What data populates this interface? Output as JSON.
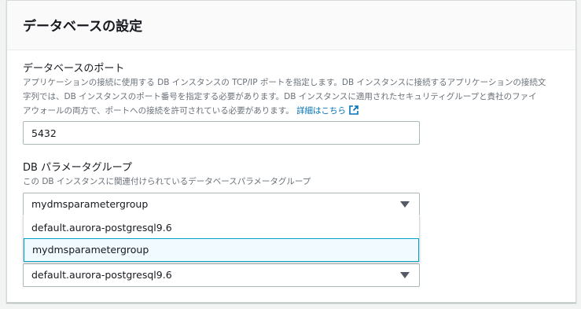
{
  "section": {
    "title": "データベースの設定"
  },
  "port": {
    "label": "データベースのポート",
    "description_line1": "アプリケーションの接続に使用する DB インスタンスの TCP/IP ポートを指定します。DB インスタンスに接続するアプリケーションの接続文",
    "description_line2": "字列では、DB インスタンスのポート番号を指定する必要があります。DB インスタンスに適用されたセキュリティグループと貴社のファイ",
    "description_line3": "アウォールの両方で、ポートへの接続を許可されている必要があります。",
    "learn_more": "詳細はこちら",
    "value": "5432"
  },
  "param_group": {
    "label": "DB パラメータグループ",
    "description": "この DB インスタンスに関連付けられているデータベースパラメータグループ",
    "selected": "mydmsparametergroup",
    "options": [
      "default.aurora-postgresql9.6",
      "mydmsparametergroup"
    ],
    "highlighted_index": 1
  },
  "second_select": {
    "selected": "default.aurora-postgresql9.6"
  },
  "colors": {
    "link": "#0073bb",
    "highlight_border": "#00a1c9",
    "highlight_bg": "#f1faff"
  }
}
